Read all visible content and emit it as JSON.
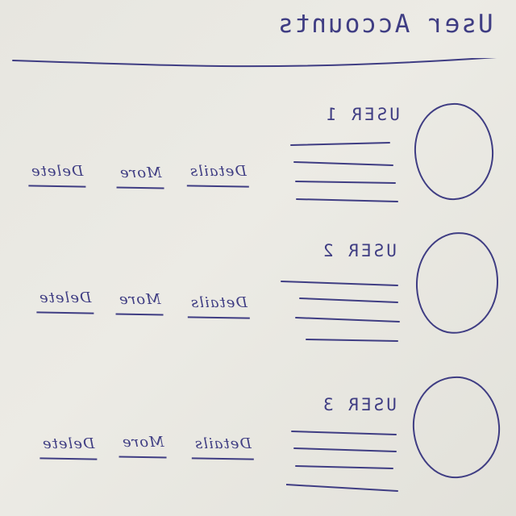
{
  "header": {
    "title": "User Accounts"
  },
  "colors": {
    "paper": "#e8e7e1",
    "ink": "#3f3d83"
  },
  "users": [
    {
      "label": "USER 1",
      "avatar_icon": "circle-avatar-icon",
      "actions": [
        "Details",
        "More",
        "Delete"
      ]
    },
    {
      "label": "USER 2",
      "avatar_icon": "circle-avatar-icon",
      "actions": [
        "Details",
        "More",
        "Delete"
      ]
    },
    {
      "label": "USER 3",
      "avatar_icon": "circle-avatar-icon",
      "actions": [
        "Details",
        "More",
        "Delete"
      ]
    }
  ]
}
